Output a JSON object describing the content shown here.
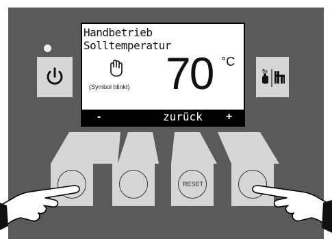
{
  "display": {
    "mode_title": "Handbetrieb",
    "setting_label": "Solltemperatur",
    "value": "70",
    "unit": "°C",
    "blink_note": "(Symbol blinkt)"
  },
  "softkeys": {
    "left": "-",
    "center": "zurück",
    "right": "+"
  },
  "buttons": {
    "reset_label": "RESET",
    "mode_key_badge": "5s"
  },
  "icons": {
    "power": "power-icon",
    "hand": "hand-icon",
    "mode": "hand-chimney-sweep-icon",
    "pointing_hands": "pointing-hand-icon"
  },
  "colors": {
    "board": "#5a5a5a",
    "key_face": "#d6d6d6",
    "led": "#eeeeee"
  }
}
